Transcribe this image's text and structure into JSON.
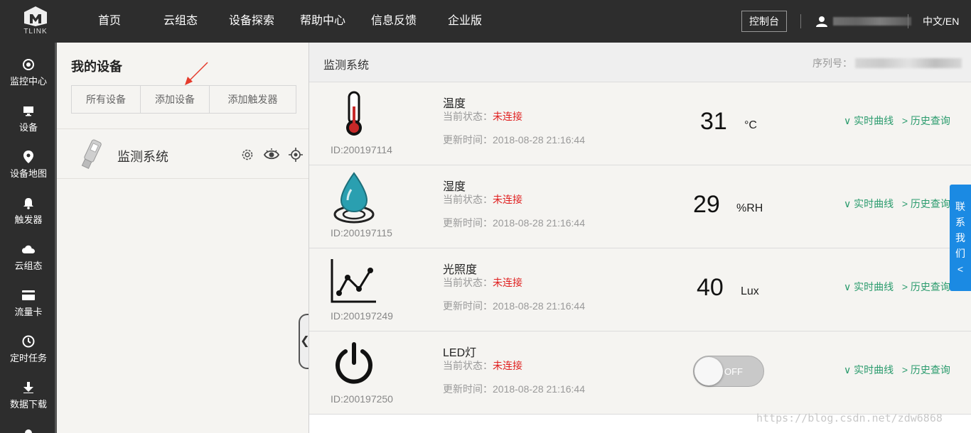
{
  "app": {
    "logo_text": "TLINK"
  },
  "nav": {
    "items": [
      "首页",
      "云组态",
      "设备探索",
      "帮助中心",
      "信息反馈",
      "企业版"
    ],
    "console": "控制台",
    "lang": "中文/EN"
  },
  "sidebar": {
    "items": [
      {
        "label": "监控中心",
        "icon": "target-icon"
      },
      {
        "label": "设备",
        "icon": "monitor-icon"
      },
      {
        "label": "设备地图",
        "icon": "map-pin-icon"
      },
      {
        "label": "触发器",
        "icon": "bell-icon"
      },
      {
        "label": "云组态",
        "icon": "cloud-icon"
      },
      {
        "label": "流量卡",
        "icon": "card-icon"
      },
      {
        "label": "定时任务",
        "icon": "clock-icon"
      },
      {
        "label": "数据下载",
        "icon": "download-icon"
      }
    ]
  },
  "devices": {
    "title": "我的设备",
    "tabs": [
      "所有设备",
      "添加设备",
      "添加触发器"
    ],
    "list": [
      {
        "name": "监测系统"
      }
    ]
  },
  "main": {
    "title": "监测系统",
    "serial_label": "序列号："
  },
  "sensors": [
    {
      "id": "ID:200197114",
      "name": "温度",
      "state_label": "当前状态：",
      "state": "未连接",
      "time": "更新时间：2018-08-28 21:16:44",
      "value": "31",
      "unit": "°C",
      "icon": "thermometer-icon"
    },
    {
      "id": "ID:200197115",
      "name": "湿度",
      "state_label": "当前状态：",
      "state": "未连接",
      "time": "更新时间：2018-08-28 21:16:44",
      "value": "29",
      "unit": "%RH",
      "icon": "water-drop-icon"
    },
    {
      "id": "ID:200197249",
      "name": "光照度",
      "state_label": "当前状态：",
      "state": "未连接",
      "time": "更新时间：2018-08-28 21:16:44",
      "value": "40",
      "unit": "Lux",
      "icon": "line-chart-icon"
    },
    {
      "id": "ID:200197250",
      "name": "LED灯",
      "state_label": "当前状态：",
      "state": "未连接",
      "time": "更新时间：2018-08-28 21:16:44",
      "switch": "OFF",
      "icon": "power-icon"
    }
  ],
  "links": {
    "realtime": "∨ 实时曲线",
    "history": "> 历史查询"
  },
  "contact": [
    "联",
    "系",
    "我",
    "们",
    "<"
  ],
  "watermark": "https://blog.csdn.net/zdw6868",
  "colors": {
    "topbar": "#2d2d2d",
    "link": "#2a9b6d",
    "disconnected": "#e02020",
    "contact": "#1b8ae3"
  }
}
